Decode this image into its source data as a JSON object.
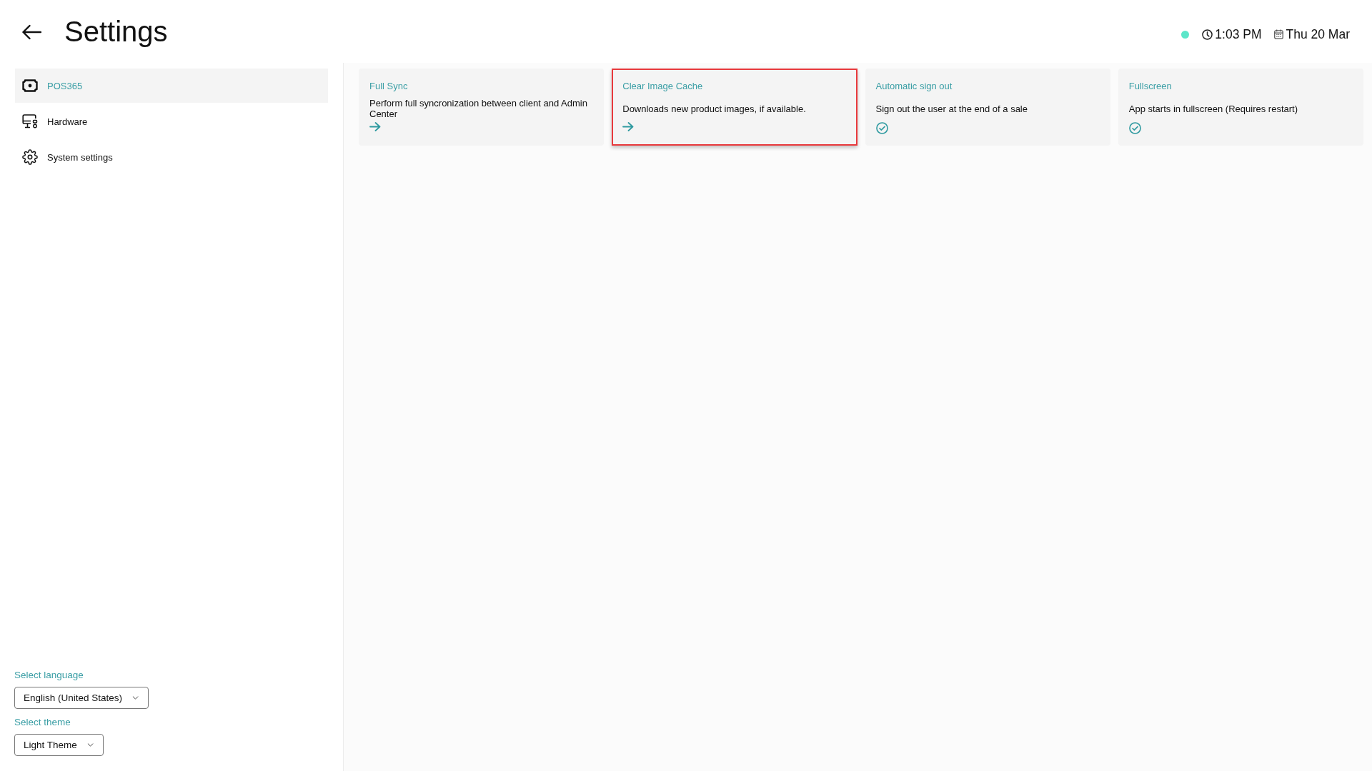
{
  "header": {
    "title": "Settings",
    "connected": true,
    "time": "1:03 PM",
    "date": "Thu 20 Mar"
  },
  "sidebar": {
    "items": [
      {
        "label": "POS365",
        "selected": true
      },
      {
        "label": "Hardware",
        "selected": false
      },
      {
        "label": "System settings",
        "selected": false
      }
    ],
    "language": {
      "label": "Select language",
      "value": "English (United States)"
    },
    "theme": {
      "label": "Select theme",
      "value": "Light Theme"
    }
  },
  "cards": [
    {
      "title": "Full Sync",
      "description": "Perform full syncronization between client and Admin Center",
      "kind": "action",
      "highlighted": false
    },
    {
      "title": "Clear Image Cache",
      "description": "Downloads new product images, if available.",
      "kind": "action",
      "highlighted": true
    },
    {
      "title": "Automatic sign out",
      "description": "Sign out the user at the end of a sale",
      "kind": "toggle",
      "checked": true,
      "highlighted": false
    },
    {
      "title": "Fullscreen",
      "description": "App starts in fullscreen (Requires restart)",
      "kind": "toggle",
      "checked": true,
      "highlighted": false
    }
  ]
}
